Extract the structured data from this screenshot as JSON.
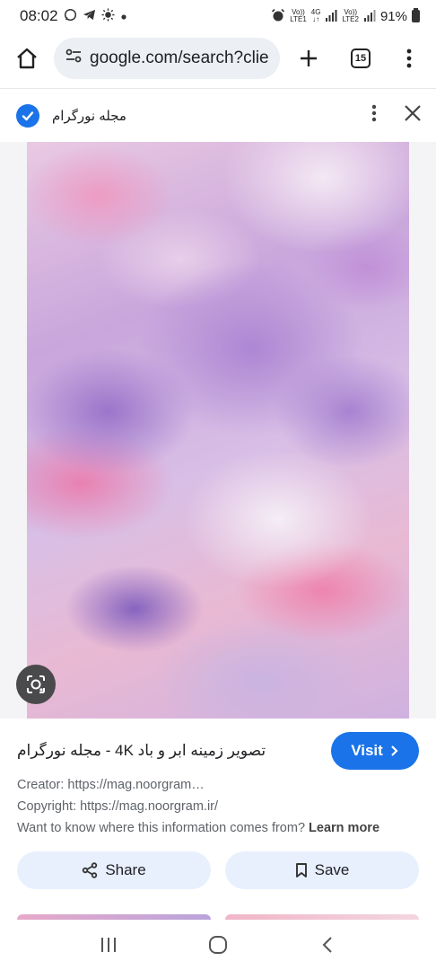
{
  "status_bar": {
    "time": "08:02",
    "battery": "91%",
    "network_1_top": "Vo))",
    "network_1_bottom": "LTE1",
    "network_gen": "4G",
    "network_2_top": "Vo))",
    "network_2_bottom": "LTE2",
    "left_icons": [
      "whatsapp-icon",
      "telegram-icon",
      "brightness-icon",
      "dot-icon"
    ]
  },
  "browser": {
    "url": "google.com/search?clie",
    "tab_count": "15"
  },
  "viewer": {
    "site_name": "مجله نورگرام",
    "image_title": "تصویر زمینه ابر و باد 4K - مجله نورگرام",
    "visit_label": "Visit",
    "creator": "Creator: https://mag.noorgram…",
    "copyright": "Copyright: https://mag.noorgram.ir/",
    "info_question": "Want to know where this information comes from?",
    "learn_more": "Learn more",
    "share_label": "Share",
    "save_label": "Save"
  },
  "colors": {
    "accent": "#1a73e8",
    "button_bg": "#e8f0fe",
    "url_bar_bg": "#eceff3"
  }
}
